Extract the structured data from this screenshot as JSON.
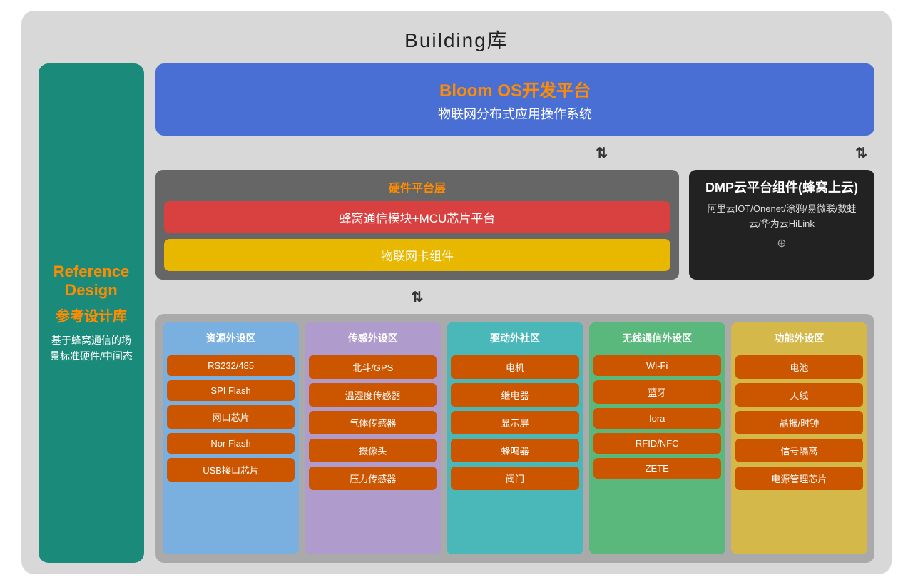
{
  "page": {
    "title": "Building库"
  },
  "sidebar": {
    "title_en_line1": "Reference",
    "title_en_line2": "Design",
    "title_cn": "参考设计库",
    "desc": "基于蜂窝通信的场景标准硬件/中间态"
  },
  "bloom_os": {
    "title": "Bloom OS开发平台",
    "subtitle": "物联网分布式应用操作系统"
  },
  "hardware": {
    "section_title": "硬件平台层",
    "row1": "蜂窝通信模块+MCU芯片平台",
    "row2": "物联网卡组件"
  },
  "dmp": {
    "title": "DMP云平台组件(蜂窝上云)",
    "subtitle": "阿里云IOT/Onenet/涂鸦/易微联/数蛙云/华为云HiLink",
    "plus": "⊕"
  },
  "peripherals": {
    "columns": [
      {
        "id": "resources",
        "header": "资源外设区",
        "color": "blue",
        "items": [
          "RS232/485",
          "SPI Flash",
          "网口芯片",
          "Nor Flash",
          "USB接口芯片"
        ]
      },
      {
        "id": "sensors",
        "header": "传感外设区",
        "color": "purple",
        "items": [
          "北斗/GPS",
          "温湿度传感器",
          "气体传感器",
          "摄像头",
          "压力传感器"
        ]
      },
      {
        "id": "drivers",
        "header": "驱动外社区",
        "color": "teal",
        "items": [
          "电机",
          "继电器",
          "显示屏",
          "蜂鸣器",
          "阀门"
        ]
      },
      {
        "id": "wireless",
        "header": "无线通信外设区",
        "color": "green",
        "items": [
          "Wi-Fi",
          "蓝牙",
          "Iora",
          "RFID/NFC",
          "ZETE"
        ]
      },
      {
        "id": "functions",
        "header": "功能外设区",
        "color": "yellow",
        "items": [
          "电池",
          "天线",
          "晶振/时钟",
          "信号隔离",
          "电源管理芯片"
        ]
      }
    ]
  }
}
